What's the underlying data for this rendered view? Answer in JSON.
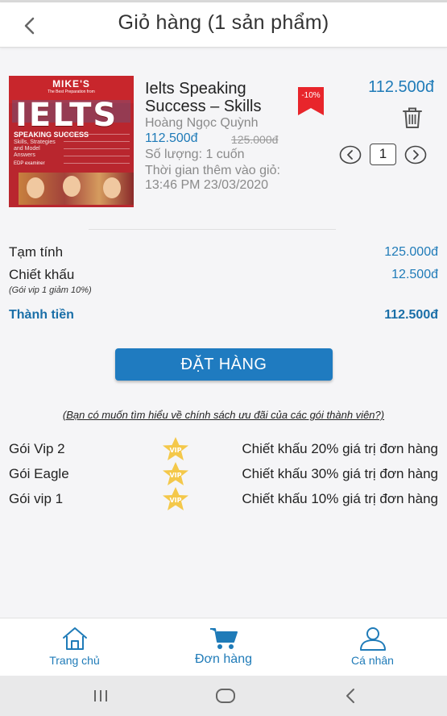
{
  "header": {
    "title": "Giỏ hàng (1 sản phẩm)"
  },
  "cover": {
    "brand": "MIKE'S",
    "tagline": "The Best Preparation from",
    "word": "IELTS",
    "subtitle": "SPEAKING SUCCESS",
    "subtitle2": "Skills, Strategies and Model Answers",
    "edition": "EDP examiner"
  },
  "item": {
    "title": "Ielts Speaking Success – Skills",
    "author": "Hoàng Ngọc Quỳnh",
    "sale_price": "112.500đ",
    "old_price": "125.000đ",
    "quantity_text": "Số lượng: 1 cuốn",
    "added_label": "Thời gian thêm vào giỏ:",
    "added_time": "13:46 PM 23/03/2020",
    "discount": "-10%",
    "price": "112.500đ",
    "quantity": "1"
  },
  "summary": {
    "subtotal_label": "Tạm tính",
    "subtotal_value": "125.000đ",
    "discount_label": "Chiết khấu",
    "discount_value": "12.500đ",
    "discount_note": "(Gói vip 1 giảm 10%)",
    "total_label": "Thành tiền",
    "total_value": "112.500đ"
  },
  "order_button": "ĐẶT HÀNG",
  "policy_link": "(Bạn có muốn tìm hiểu về chính sách ưu đãi của các gói thành viên?)",
  "packages": [
    {
      "name": "Gói Vip 2",
      "badge": "VIP",
      "desc": "Chiết khấu 20% giá trị đơn hàng"
    },
    {
      "name": "Gói Eagle",
      "badge": "VIP",
      "desc": "Chiết khấu 30% giá trị đơn hàng"
    },
    {
      "name": "Gói vip 1",
      "badge": "VIP",
      "desc": "Chiết khấu 10% giá trị đơn hàng"
    }
  ],
  "nav": {
    "home": "Trang chủ",
    "orders": "Đơn hàng",
    "profile": "Cá nhân"
  },
  "colors": {
    "accent": "#1f7bb8",
    "button": "#1f7bc0",
    "badge_red": "#e8252b",
    "vip_gold": "#f4c84a"
  }
}
